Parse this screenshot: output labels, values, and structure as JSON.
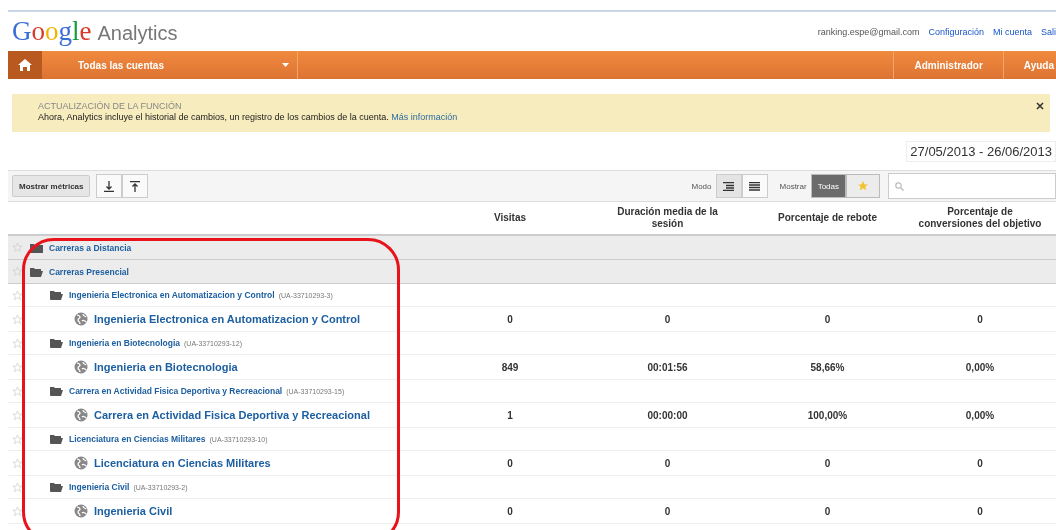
{
  "header": {
    "logo": "Google",
    "product": "Analytics",
    "email": "ranking.espe@gmail.com",
    "links": [
      "Configuración",
      "Mi cuenta",
      "Sali"
    ]
  },
  "nav": {
    "account": "Todas las cuentas",
    "items": [
      "Administrador",
      "Ayuda"
    ]
  },
  "notice": {
    "title": "ACTUALIZACIÓN DE LA FUNCIÓN",
    "text": "Ahora, Analytics incluye el historial de cambios, un registro de los cambios de la cuenta.",
    "link": "Más información"
  },
  "date_range": "27/05/2013 - 26/06/2013",
  "toolbar": {
    "metrics_button": "Mostrar métricas",
    "mode_label": "Modo",
    "modes": [
      {
        "selected": true
      },
      {
        "selected": false
      }
    ],
    "show_label": "Mostrar",
    "filters": [
      {
        "kind": "text",
        "label": "Todas",
        "selected": true
      },
      {
        "kind": "star",
        "selected": false
      }
    ]
  },
  "table": {
    "columns": [
      "Visitas",
      "Duración media de la sesión",
      "Porcentaje de rebote",
      "Porcentaje de conversiones del objetivo"
    ],
    "rows": [
      {
        "kind": "group",
        "name": "Carreras a Distancia",
        "starred": false
      },
      {
        "kind": "group",
        "name": "Carreras Presencial",
        "starred": false,
        "children": [
          {
            "kind": "folder",
            "name": "Ingenieria Electronica en Automatizacion y Control",
            "id": "(UA-33710293-3)",
            "starred": false,
            "children": [
              {
                "kind": "property",
                "name": "Ingenieria Electronica en Automatizacion y Control",
                "starred": false,
                "values": [
                  "0",
                  "0",
                  "0",
                  "0"
                ]
              }
            ]
          },
          {
            "kind": "folder",
            "name": "Ingenieria en Biotecnologia",
            "id": "(UA-33710293-12)",
            "starred": false,
            "children": [
              {
                "kind": "property",
                "name": "Ingenieria en Biotecnologia",
                "starred": false,
                "values": [
                  "849",
                  "00:01:56",
                  "58,66%",
                  "0,00%"
                ]
              }
            ]
          },
          {
            "kind": "folder",
            "name": "Carrera en Actividad Fisica Deportiva y Recreacional",
            "id": "(UA-33710293-15)",
            "starred": false,
            "children": [
              {
                "kind": "property",
                "name": "Carrera en Actividad Fisica Deportiva y Recreacional",
                "starred": false,
                "values": [
                  "1",
                  "00:00:00",
                  "100,00%",
                  "0,00%"
                ]
              }
            ]
          },
          {
            "kind": "folder",
            "name": "Licenciatura en Ciencias Militares",
            "id": "(UA-33710293-10)",
            "starred": false,
            "children": [
              {
                "kind": "property",
                "name": "Licenciatura en Ciencias Militares",
                "starred": false,
                "values": [
                  "0",
                  "0",
                  "0",
                  "0"
                ]
              }
            ]
          },
          {
            "kind": "folder",
            "name": "Ingenieria Civil",
            "id": "(UA-33710293-2)",
            "starred": false,
            "children": [
              {
                "kind": "property",
                "name": "Ingenieria Civil",
                "starred": false,
                "values": [
                  "0",
                  "0",
                  "0",
                  "0"
                ]
              }
            ]
          }
        ]
      }
    ]
  }
}
